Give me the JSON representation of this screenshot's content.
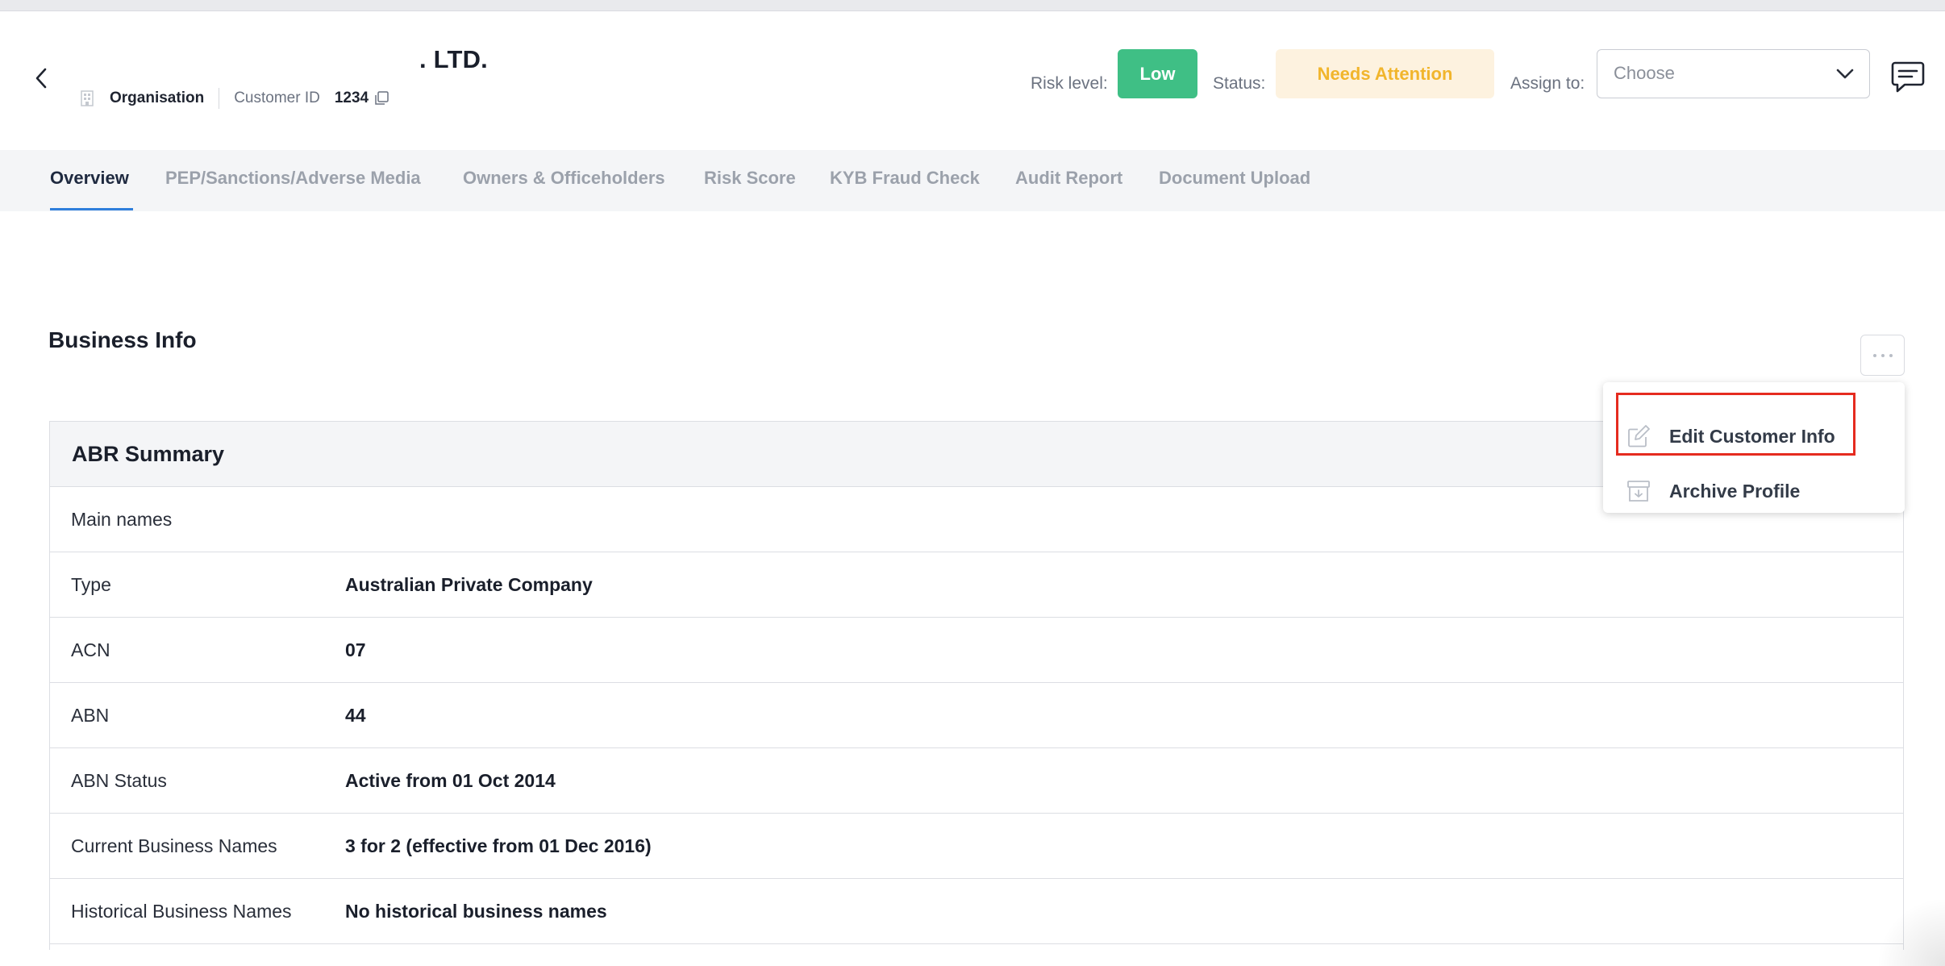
{
  "header": {
    "customer_name": ". LTD.",
    "entity_type": "Organisation",
    "customer_id_label": "Customer ID",
    "customer_id_value": "1234",
    "risk_label": "Risk level:",
    "risk_value": "Low",
    "status_label": "Status:",
    "status_value": "Needs Attention",
    "assign_label": "Assign to:",
    "assign_placeholder": "Choose"
  },
  "tabs": [
    {
      "label": "Overview",
      "active": true
    },
    {
      "label": "PEP/Sanctions/Adverse Media"
    },
    {
      "label": "Owners & Officeholders"
    },
    {
      "label": "Risk Score"
    },
    {
      "label": "KYB Fraud Check"
    },
    {
      "label": "Audit Report"
    },
    {
      "label": "Document Upload"
    }
  ],
  "business_info": {
    "title": "Business Info",
    "summary_title": "ABR Summary",
    "rows": [
      {
        "key": "Main names",
        "value": ""
      },
      {
        "key": "Type",
        "value": "Australian Private Company"
      },
      {
        "key": "ACN",
        "value": "07"
      },
      {
        "key": "ABN",
        "value": "44"
      },
      {
        "key": "ABN Status",
        "value": "Active from 01 Oct 2014"
      },
      {
        "key": "Current Business Names",
        "value": "3 for 2 (effective from 01 Dec 2016)"
      },
      {
        "key": "Historical Business Names",
        "value": "No historical business names"
      }
    ]
  },
  "menu": {
    "items": [
      {
        "label": "Edit Customer Info",
        "icon": "edit-icon"
      },
      {
        "label": "Archive Profile",
        "icon": "archive-icon"
      }
    ]
  },
  "colors": {
    "risk_low": "#3fbf85",
    "status_bg": "#fdf2df",
    "status_text": "#f1b52c",
    "tab_underline": "#2f7fdc",
    "highlight": "#e52b1f"
  }
}
